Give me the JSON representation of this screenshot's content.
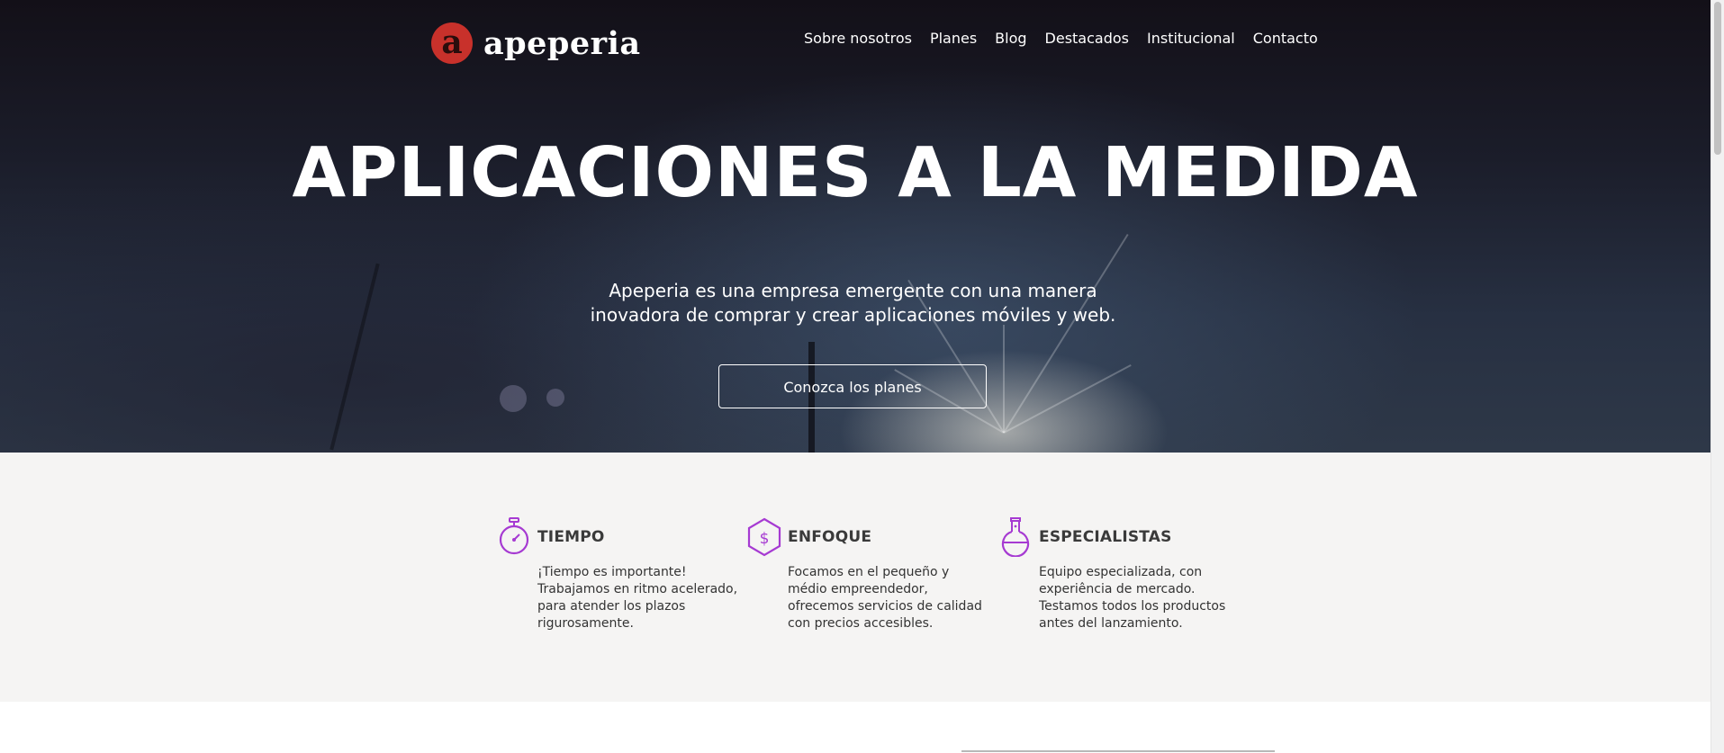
{
  "brand": {
    "logo_letter": "a",
    "name": "apeperia",
    "logo_color": "#c8312b"
  },
  "nav": {
    "items": [
      "Sobre nosotros",
      "Planes",
      "Blog",
      "Destacados",
      "Institucional",
      "Contacto"
    ]
  },
  "hero": {
    "title": "APLICACIONES A LA MEDIDA",
    "subtitle": "Apeperia es una empresa emergente con una manera inovadora de comprar y crear aplicaciones móviles y web.",
    "cta_label": "Conozca los planes"
  },
  "features": {
    "accent_color": "#a63ad2",
    "items": [
      {
        "icon": "stopwatch-icon",
        "title": "TIEMPO",
        "text": "¡Tiempo es importante! Trabajamos en ritmo acelerado, para atender los plazos rigurosamente."
      },
      {
        "icon": "dollar-hexagon-icon",
        "title": "ENFOQUE",
        "text": "Focamos en el pequeño y médio empreendedor, ofrecemos servicios de calidad con precios accesibles."
      },
      {
        "icon": "flask-icon",
        "title": "ESPECIALISTAS",
        "text": "Equipo especializada, con experiência de mercado. Testamos todos los productos antes del lanzamiento."
      }
    ]
  }
}
